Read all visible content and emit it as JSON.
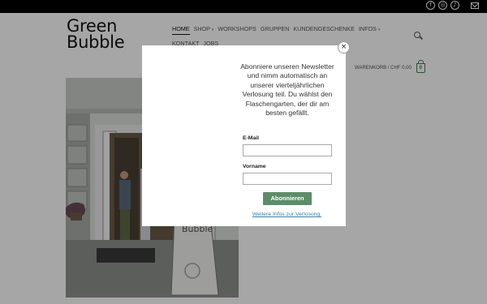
{
  "topbar": {
    "social_icons": [
      "facebook-icon",
      "instagram-icon",
      "tiktok-icon",
      "mail-icon"
    ],
    "facebook_glyph": "f",
    "instagram_glyph": "◎",
    "tiktok_glyph": "♪"
  },
  "logo": {
    "line1": "Green",
    "line2": "Bubble"
  },
  "nav": {
    "items": [
      {
        "label": "Home",
        "active": true
      },
      {
        "label": "Shop",
        "has_dropdown": true
      },
      {
        "label": "Workshops"
      },
      {
        "label": "Gruppen"
      },
      {
        "label": "Kundengeschenke"
      },
      {
        "label": "Infos",
        "has_dropdown": true
      },
      {
        "label": "Kontakt"
      },
      {
        "label": "Jobs"
      }
    ],
    "chevron": "▾"
  },
  "cart": {
    "label": "Warenkorb / CHF 0.00",
    "count": "0"
  },
  "popup": {
    "close_glyph": "×",
    "text": "Abonniere unseren Newsletter und nimm automatisch an unserer vierteljährlichen Verlosung teil. Du wählst den Flaschengarten, der dir am besten gefällt.",
    "email_label": "E-Mail",
    "email_value": "",
    "name_label": "Vorname",
    "name_value": "",
    "submit_label": "Abonnieren",
    "more_link": "Weitere Infos zur Verlosung."
  },
  "hero": {
    "sign_text": "Bubble"
  },
  "colors": {
    "accent_green": "#5e8c6a",
    "link_blue": "#3b7fa8",
    "topbar": "#000000"
  }
}
